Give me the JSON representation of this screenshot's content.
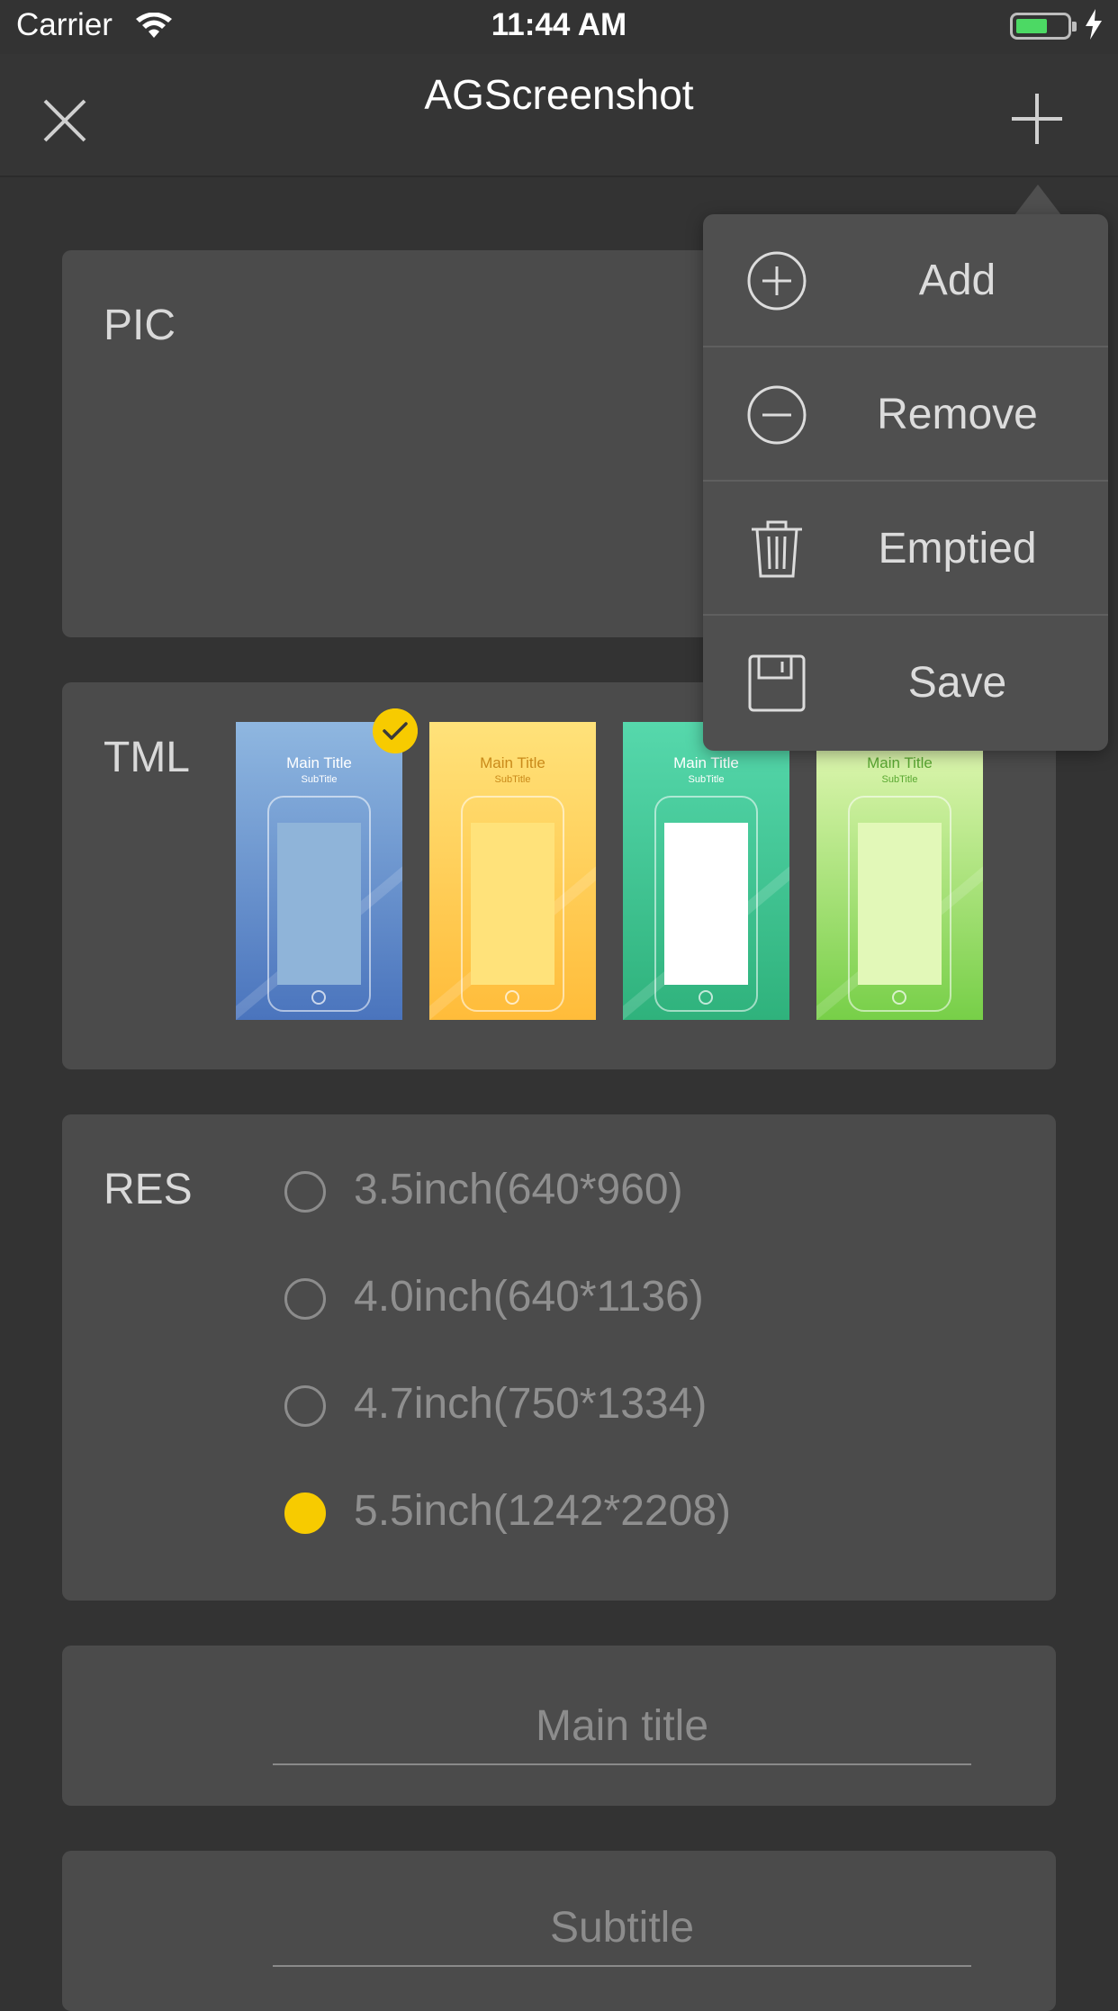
{
  "status_bar": {
    "carrier": "Carrier",
    "time": "11:44 AM"
  },
  "nav": {
    "title": "AGScreenshot",
    "close_icon": "close-icon",
    "add_icon": "plus-icon"
  },
  "pic": {
    "label": "PIC"
  },
  "tml": {
    "label": "TML",
    "selected_index": 0,
    "templates": [
      {
        "main_title": "Main Title",
        "subtitle": "SubTitle",
        "colors": [
          "#8fb7e0",
          "#4a74bd"
        ],
        "screen": "#8fb4d9",
        "text_color": "#ffffff",
        "selected": true
      },
      {
        "main_title": "Main Title",
        "subtitle": "SubTitle",
        "colors": [
          "#ffe27a",
          "#ffbc3a"
        ],
        "screen": "#ffe27a",
        "text_color": "#c98a1a",
        "selected": false
      },
      {
        "main_title": "Main Title",
        "subtitle": "SubTitle",
        "colors": [
          "#56d8ac",
          "#2fb27c"
        ],
        "screen": "#ffffff",
        "text_color": "#ffffff",
        "selected": false
      },
      {
        "main_title": "Main Title",
        "subtitle": "SubTitle",
        "colors": [
          "#e6f9b8",
          "#77cf48"
        ],
        "screen": "#e2f8b8",
        "text_color": "#5aa832",
        "selected": false
      }
    ]
  },
  "res": {
    "label": "RES",
    "options": [
      {
        "label": "3.5inch(640*960)",
        "selected": false
      },
      {
        "label": "4.0inch(640*1136)",
        "selected": false
      },
      {
        "label": "4.7inch(750*1334)",
        "selected": false
      },
      {
        "label": "5.5inch(1242*2208)",
        "selected": true
      }
    ]
  },
  "inputs": {
    "main_title_placeholder": "Main title",
    "subtitle_placeholder": "Subtitle"
  },
  "menu": {
    "items": [
      {
        "label": "Add",
        "icon": "add-circle-icon"
      },
      {
        "label": "Remove",
        "icon": "remove-circle-icon"
      },
      {
        "label": "Emptied",
        "icon": "trash-icon"
      },
      {
        "label": "Save",
        "icon": "save-icon"
      }
    ]
  },
  "colors": {
    "background": "#333333",
    "card": "#4b4b4b",
    "accent_yellow": "#f7cb00",
    "battery_green": "#4cd964",
    "menu": "#4f4f4f"
  }
}
